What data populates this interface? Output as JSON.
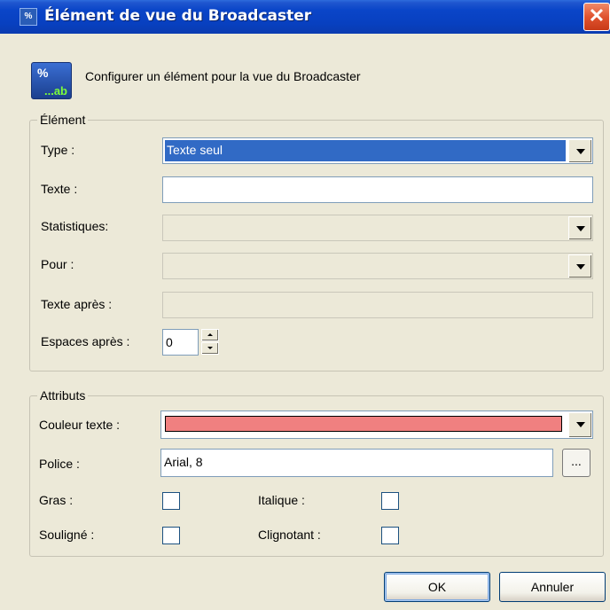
{
  "window": {
    "title": "Élément de vue du Broadcaster",
    "close_glyph": "✕",
    "icon": "broadcaster-app-icon",
    "icon_text": "%"
  },
  "header": {
    "icon": "percent-ab-icon",
    "icon_pct": "%",
    "icon_ab": "...ab",
    "description": "Configurer un élément pour la vue du Broadcaster"
  },
  "element_group": {
    "legend": "Élément",
    "type_label": "Type :",
    "type_value": "Texte seul",
    "texte_label": "Texte :",
    "texte_value": "",
    "statistiques_label": "Statistiques:",
    "statistiques_value": "",
    "pour_label": "Pour :",
    "pour_value": "",
    "texte_apres_label": "Texte après :",
    "texte_apres_value": "",
    "espaces_apres_label": "Espaces après :",
    "espaces_apres_value": "0"
  },
  "attributs_group": {
    "legend": "Attributs",
    "couleur_label": "Couleur texte :",
    "couleur_value": "#f08080",
    "police_label": "Police :",
    "police_value": "Arial, 8",
    "police_browse": "...",
    "gras_label": "Gras :",
    "italique_label": "Italique :",
    "souligne_label": "Souligné :",
    "clignotant_label": "Clignotant :",
    "gras_checked": false,
    "italique_checked": false,
    "souligne_checked": false,
    "clignotant_checked": false
  },
  "buttons": {
    "ok": "OK",
    "cancel": "Annuler"
  }
}
